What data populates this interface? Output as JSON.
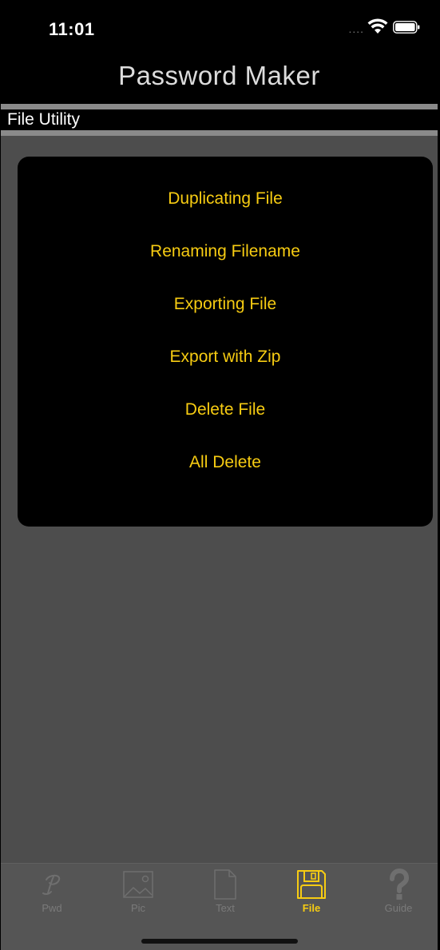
{
  "status_bar": {
    "time": "11:01",
    "signal": "....",
    "wifi_icon": "wifi-icon",
    "battery_icon": "battery-icon"
  },
  "nav": {
    "title": "Password Maker"
  },
  "section": {
    "header": "File Utility"
  },
  "menu": {
    "items": [
      "Duplicating File",
      "Renaming Filename",
      "Exporting File",
      "Export with Zip",
      "Delete File",
      "All Delete"
    ]
  },
  "tabs": [
    {
      "label": "Pwd",
      "icon": "script-p-icon",
      "active": false
    },
    {
      "label": "Pic",
      "icon": "picture-icon",
      "active": false
    },
    {
      "label": "Text",
      "icon": "document-icon",
      "active": false
    },
    {
      "label": "File",
      "icon": "floppy-disk-icon",
      "active": true
    },
    {
      "label": "Guide",
      "icon": "question-mark-icon",
      "active": false
    }
  ],
  "colors": {
    "accent": "#f7cc12",
    "background": "#4d4d4d",
    "inactive_tab": "#7a7a7a"
  }
}
